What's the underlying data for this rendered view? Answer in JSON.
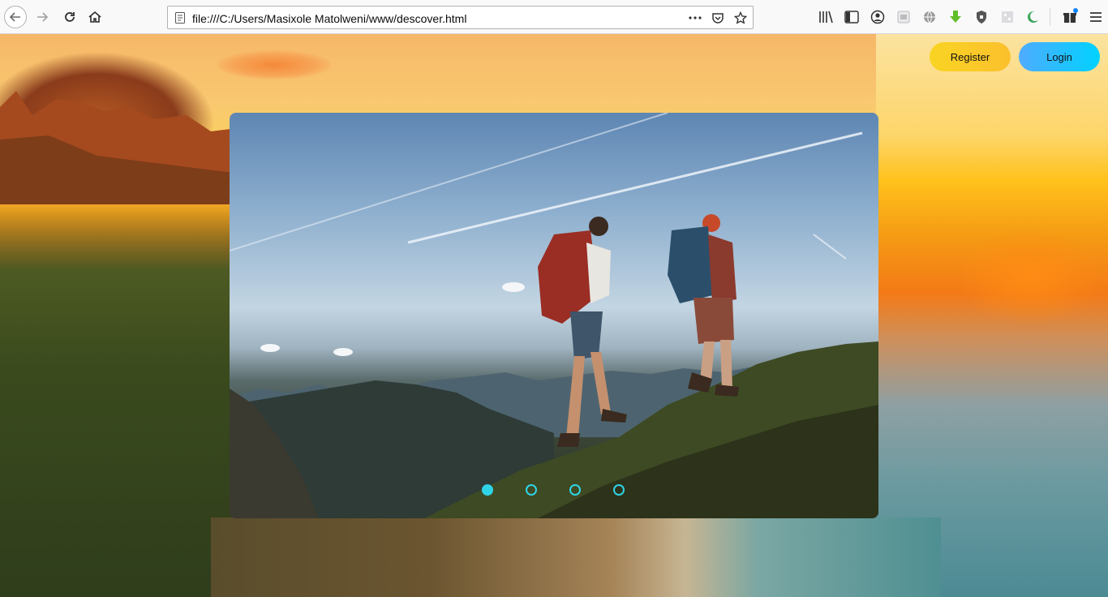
{
  "browser": {
    "url": "file:///C:/Users/Masixole Matolweni/www/descover.html",
    "icons": {
      "back": "back-arrow-icon",
      "forward": "forward-arrow-icon",
      "reload": "reload-icon",
      "home": "home-icon",
      "page_actions": "more-dots-icon",
      "pocket": "pocket-icon",
      "bookmark": "star-icon",
      "library": "library-icon",
      "sidebar": "sidebar-icon",
      "account": "account-icon",
      "menu": "hamburger-menu-icon"
    }
  },
  "header": {
    "register_label": "Register",
    "login_label": "Login"
  },
  "carousel": {
    "slide_count": 4,
    "active_index": 0,
    "accent_color": "#2fd3e6"
  }
}
